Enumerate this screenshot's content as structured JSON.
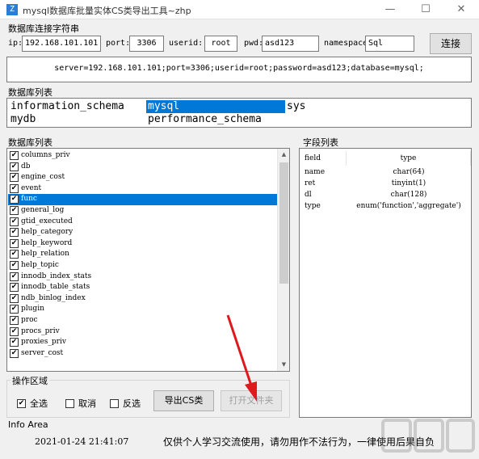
{
  "window": {
    "title": "mysql数据库批量实体CS类导出工具~zhp",
    "icon": "app-icon",
    "controls": [
      "—",
      "☐",
      "✕"
    ]
  },
  "connection": {
    "group_label": "数据库连接字符串",
    "ip_label": "ip:",
    "ip_value": "192.168.101.101",
    "port_label": "port:",
    "port_value": "3306",
    "userid_label": "userid:",
    "userid_value": "root",
    "pwd_label": "pwd:",
    "pwd_value": "asd123",
    "namespace_label": "namespace:",
    "namespace_value": "Sql",
    "connect_button": "连接",
    "connection_string": "server=192.168.101.101;port=3306;userid=root;password=asd123;database=mysql;"
  },
  "database_list": {
    "group_label": "数据库列表",
    "items": [
      "information_schema",
      "mysql",
      "sys",
      "mydb",
      "performance_schema"
    ],
    "selected": "mysql"
  },
  "table_list": {
    "group_label": "数据库列表",
    "selected": "func",
    "items": [
      {
        "name": "columns_priv",
        "checked": true
      },
      {
        "name": "db",
        "checked": true
      },
      {
        "name": "engine_cost",
        "checked": true
      },
      {
        "name": "event",
        "checked": true
      },
      {
        "name": "func",
        "checked": true
      },
      {
        "name": "general_log",
        "checked": true
      },
      {
        "name": "gtid_executed",
        "checked": true
      },
      {
        "name": "help_category",
        "checked": true
      },
      {
        "name": "help_keyword",
        "checked": true
      },
      {
        "name": "help_relation",
        "checked": true
      },
      {
        "name": "help_topic",
        "checked": true
      },
      {
        "name": "innodb_index_stats",
        "checked": true
      },
      {
        "name": "innodb_table_stats",
        "checked": true
      },
      {
        "name": "ndb_binlog_index",
        "checked": true
      },
      {
        "name": "plugin",
        "checked": true
      },
      {
        "name": "proc",
        "checked": true
      },
      {
        "name": "procs_priv",
        "checked": true
      },
      {
        "name": "proxies_priv",
        "checked": true
      },
      {
        "name": "server_cost",
        "checked": true
      }
    ]
  },
  "field_list": {
    "group_label": "字段列表",
    "headers": [
      "field",
      "type"
    ],
    "rows": [
      {
        "field": "name",
        "type": "char(64)"
      },
      {
        "field": "ret",
        "type": "tinyint(1)"
      },
      {
        "field": "dl",
        "type": "char(128)"
      },
      {
        "field": "type",
        "type": "enum('function','aggregate')"
      }
    ]
  },
  "operations": {
    "group_label": "操作区域",
    "select_all": {
      "label": "全选",
      "checked": true
    },
    "cancel": {
      "label": "取消",
      "checked": false
    },
    "invert": {
      "label": "反选",
      "checked": false
    },
    "export_button": "导出CS类",
    "open_button": "打开文件夹",
    "open_button_enabled": false
  },
  "info_area": {
    "group_label": "Info Area",
    "timestamp": "2021-01-24 21:41:07",
    "notice": "仅供个人学习交流使用，请勿用作不法行为，一律使用后果自负"
  },
  "colors": {
    "selection": "#0078d7",
    "annotation_arrow": "#e0191f"
  },
  "watermark": {
    "text": "下载吧"
  }
}
